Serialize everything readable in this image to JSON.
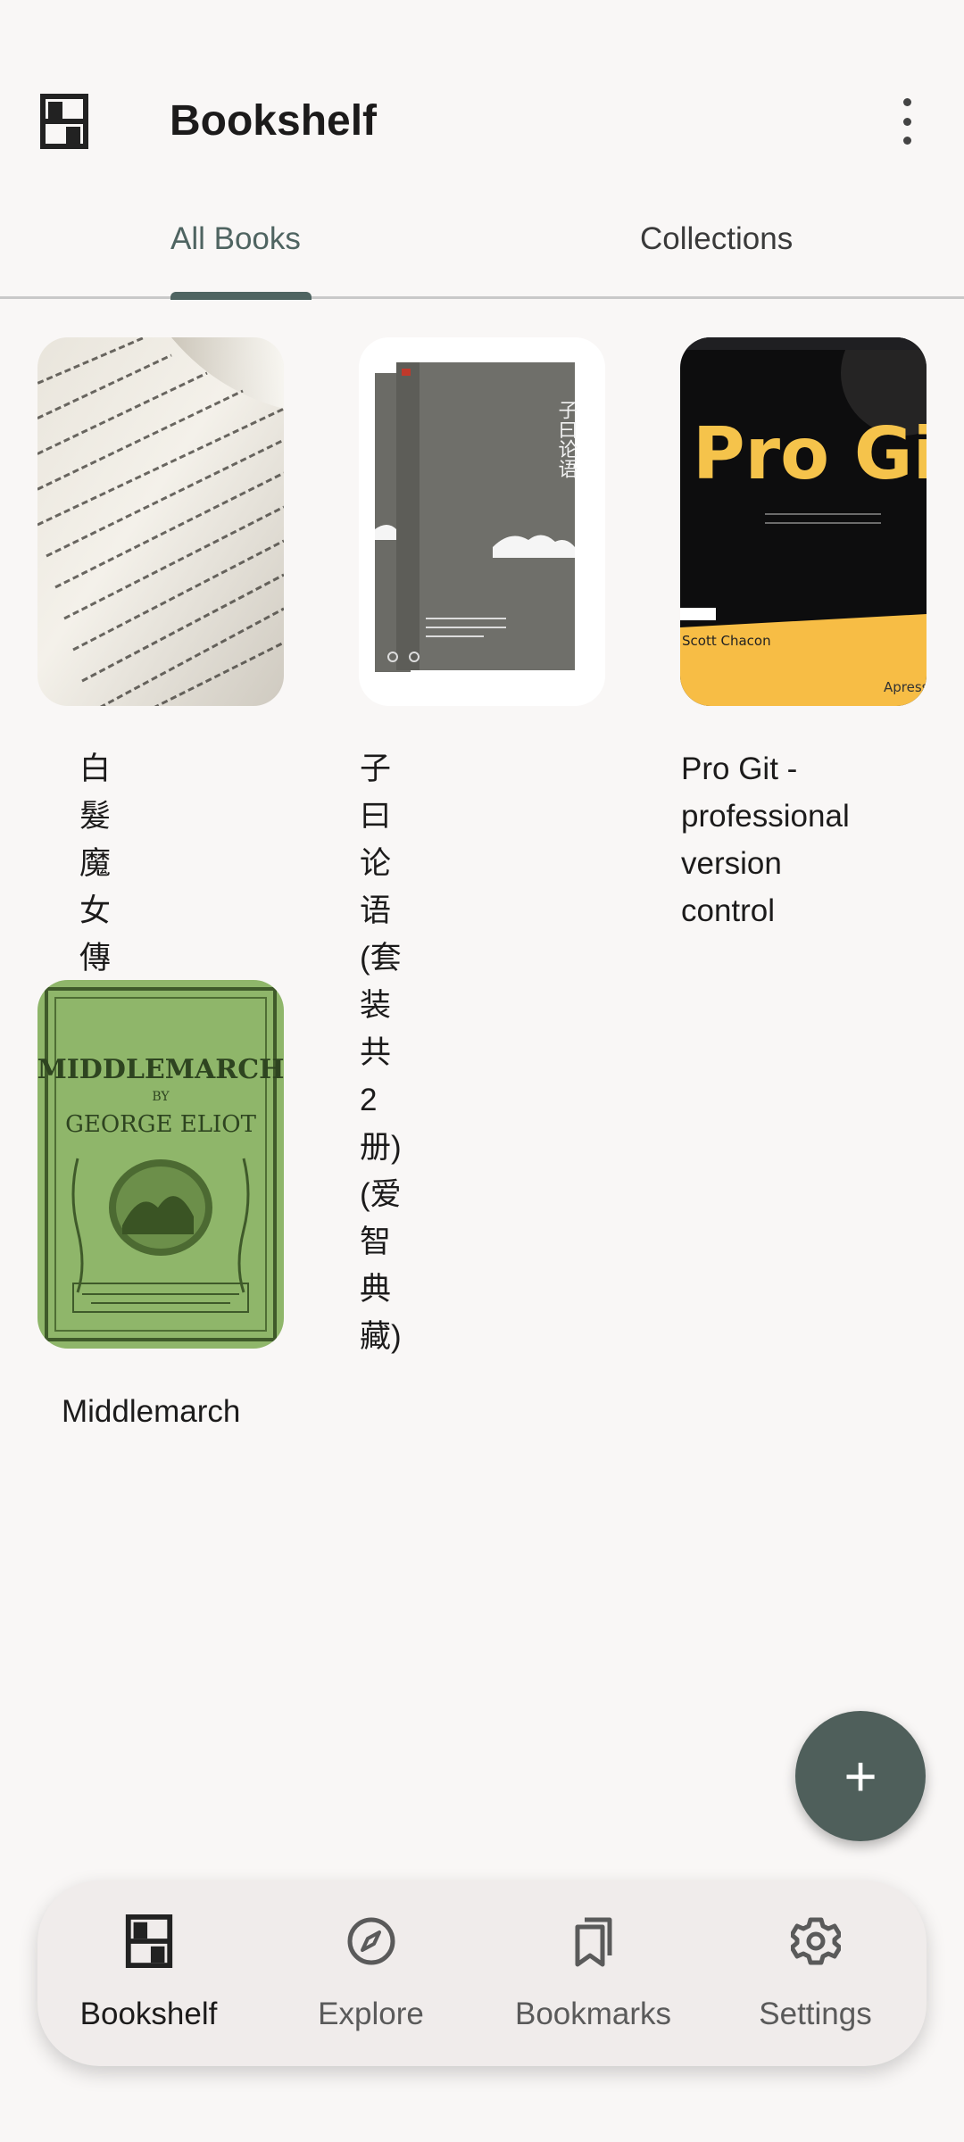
{
  "app_bar": {
    "title": "Bookshelf",
    "icon": "bookshelf-icon",
    "overflow_icon": "more-vert-icon"
  },
  "tabs": [
    {
      "label": "All Books",
      "selected": true
    },
    {
      "label": "Collections",
      "selected": false
    }
  ],
  "books": [
    {
      "title": "白髮魔女傳",
      "cover": "open-book-page-photo"
    },
    {
      "title": "子曰论语(套装共2册) (爱智典藏)",
      "title_lines": [
        "子曰论语(套装共",
        "2册) (爱智典藏)"
      ],
      "cover": "gray-boxed-set-cover",
      "cover_text": "子曰论语"
    },
    {
      "title": "Pro Git - professional version control",
      "title_lines": [
        "Pro Git -",
        "professional",
        "version control"
      ],
      "cover": "pro-git-cover",
      "cover_text": "Pro Git",
      "cover_author": "Scott Chacon",
      "cover_publisher": "Apress"
    },
    {
      "title": "Middlemarch",
      "cover": "middlemarch-green-cover",
      "cover_text": "MIDDLEMARCH",
      "cover_by": "BY",
      "cover_author": "GEORGE ELIOT"
    }
  ],
  "fab": {
    "icon": "plus-icon",
    "label": "+"
  },
  "bottom_nav": [
    {
      "label": "Bookshelf",
      "icon": "bookshelf-icon",
      "selected": true
    },
    {
      "label": "Explore",
      "icon": "compass-icon",
      "selected": false
    },
    {
      "label": "Bookmarks",
      "icon": "bookmarks-icon",
      "selected": false
    },
    {
      "label": "Settings",
      "icon": "gear-icon",
      "selected": false
    }
  ],
  "colors": {
    "background": "#f9f7f6",
    "accent": "#4f6461",
    "fab": "#4f5f5b",
    "nav_bar": "#f0eceb"
  }
}
